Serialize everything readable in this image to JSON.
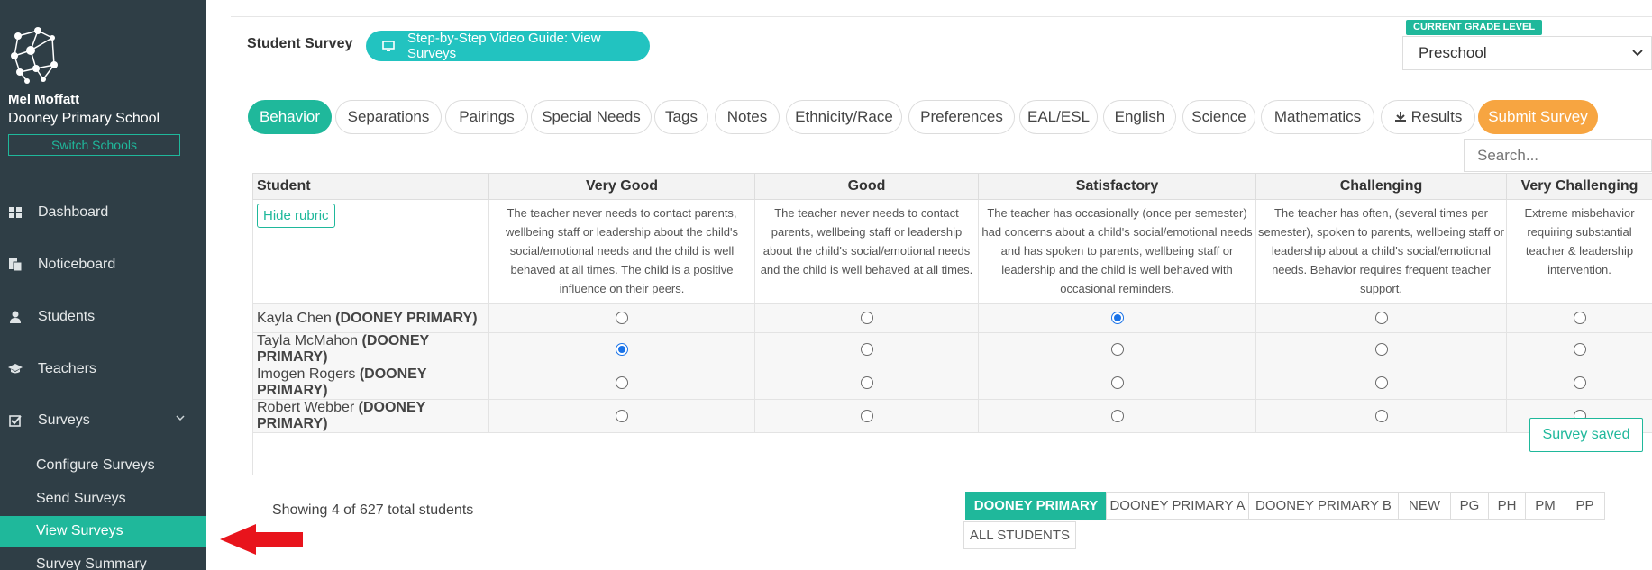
{
  "sidebar": {
    "user_name": "Mel Moffatt",
    "school_name": "Dooney Primary School",
    "switch_label": "Switch Schools",
    "nav": {
      "dashboard": "Dashboard",
      "noticeboard": "Noticeboard",
      "students": "Students",
      "teachers": "Teachers",
      "surveys": "Surveys"
    },
    "subnav": {
      "configure": "Configure Surveys",
      "send": "Send Surveys",
      "view": "View Surveys",
      "summary": "Survey Summary"
    }
  },
  "header": {
    "title": "Student Survey",
    "guide_label": "Step-by-Step Video Guide: View Surveys",
    "grade_label": "CURRENT GRADE LEVEL",
    "grade_value": "Preschool"
  },
  "tabs": {
    "behavior": "Behavior",
    "separations": "Separations",
    "pairings": "Pairings",
    "special_needs": "Special Needs",
    "tags": "Tags",
    "notes": "Notes",
    "ethnicity": "Ethnicity/Race",
    "preferences": "Preferences",
    "eal": "EAL/ESL",
    "english": "English",
    "science": "Science",
    "mathematics": "Mathematics",
    "results": "Results",
    "submit": "Submit Survey"
  },
  "search_placeholder": "Search...",
  "table": {
    "columns": {
      "student": "Student",
      "c1": "Very Good",
      "c2": "Good",
      "c3": "Satisfactory",
      "c4": "Challenging",
      "c5": "Very Challenging"
    },
    "hide_rubric": "Hide rubric",
    "rubric": {
      "c1": "The teacher never needs to contact parents, wellbeing staff or leadership about the child's social/emotional needs and the child is well behaved at all times. The child is a positive influence on their peers.",
      "c2": "The teacher never needs to contact parents, wellbeing staff or leadership about the child's social/emotional needs and the child is well behaved at all times.",
      "c3": "The teacher has occasionally (once per semester) had concerns about a child's social/emotional needs and has spoken to parents, wellbeing staff or leadership and the child is well behaved with occasional reminders.",
      "c4": "The teacher has often, (several times per semester), spoken to parents, wellbeing staff or leadership about a child's social/emotional needs. Behavior requires frequent teacher support.",
      "c5": "Extreme misbehavior requiring substantial teacher & leadership intervention."
    },
    "rows": [
      {
        "name": "Kayla Chen",
        "school": "(DOONEY PRIMARY)",
        "selected": 3
      },
      {
        "name": "Tayla McMahon",
        "school": "(DOONEY PRIMARY)",
        "selected": 1
      },
      {
        "name": "Imogen Rogers",
        "school": "(DOONEY PRIMARY)",
        "selected": 0
      },
      {
        "name": "Robert Webber",
        "school": "(DOONEY PRIMARY)",
        "selected": 0
      }
    ],
    "saved_label": "Survey saved"
  },
  "showing_text": "Showing 4 of 627 total students",
  "filters": {
    "f1": "DOONEY PRIMARY",
    "f2": "DOONEY PRIMARY A",
    "f3": "DOONEY PRIMARY B",
    "f4": "NEW",
    "f5": "PG",
    "f6": "PH",
    "f7": "PM",
    "f8": "PP",
    "f9": "ALL STUDENTS"
  },
  "colors": {
    "sidebar": "#2f3e46",
    "accent": "#1fb89b",
    "guide": "#22c3c0",
    "submit": "#f7a541",
    "arrow": "#e8141c"
  }
}
